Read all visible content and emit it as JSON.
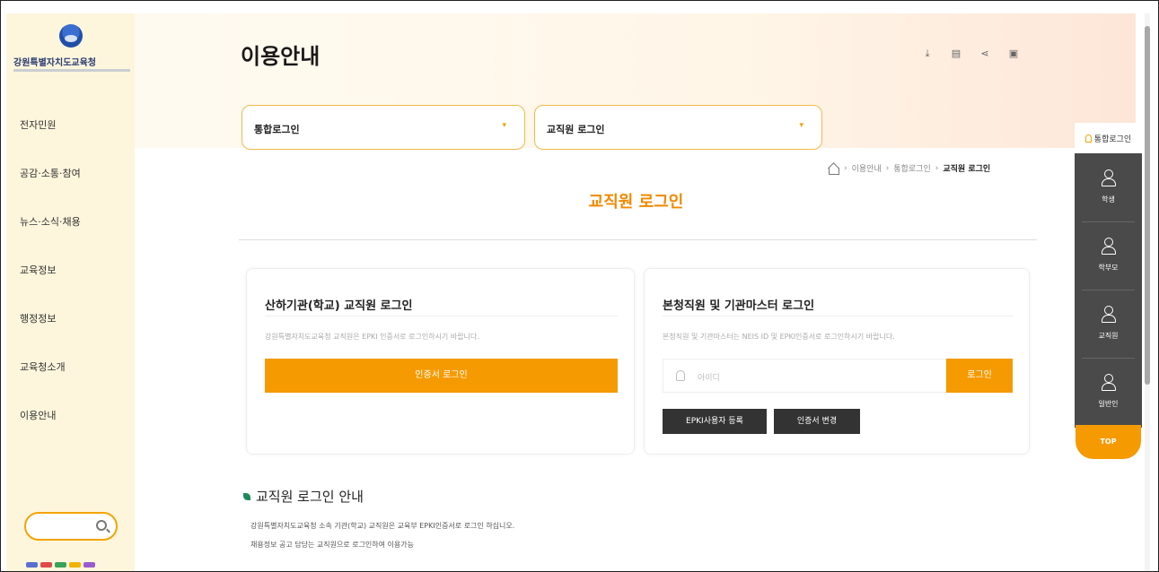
{
  "sidebar": {
    "logo_text": "강원특별자치도교육청",
    "nav_items": [
      "전자민원",
      "공감·소통·참여",
      "뉴스·소식·채용",
      "교육정보",
      "행정정보",
      "교육청소개",
      "이용안내"
    ],
    "color_dots": [
      "#5a6fd1",
      "#e04a4a",
      "#3aa35a",
      "#f0b400",
      "#9a5ad1"
    ]
  },
  "header": {
    "title": "이용안내",
    "util_icons": [
      "download-icon",
      "print-icon",
      "share-icon",
      "printer-icon"
    ]
  },
  "selects": {
    "primary": "통합로그인",
    "secondary": "교직원 로그인"
  },
  "breadcrumb": {
    "items": [
      "이용안내",
      "통합로그인"
    ],
    "current": "교직원 로그인",
    "separator": "›"
  },
  "section": {
    "title": "교직원 로그인"
  },
  "card_left": {
    "title": "산하기관(학교) 교직원 로그인",
    "desc": "강원특별자치도교육청 교직원은 EPKI 인증서로 로그인하시기 바랍니다.",
    "button": "인증서 로그인"
  },
  "card_right": {
    "title": "본청직원 및 기관마스터 로그인",
    "desc": "본청직원 및 기관마스터는 NEIS ID 및 EPKI인증서로 로그인하시기 바랍니다.",
    "id_placeholder": "아이디",
    "login_button": "로그인",
    "epki_button": "EPKI사용자 등록",
    "cert_change_button": "인증서 변경"
  },
  "guide": {
    "title": "교직원 로그인 안내",
    "lines": [
      "강원특별자치도교육청 소속 기관(학교) 교직원은 교육부 EPKI인증서로 로그인 하십니오.",
      "채용정보 공고 담당는 교직원으로 로그인하여 이용가능"
    ]
  },
  "quick": {
    "top_label": "통합로그인",
    "items": [
      "학생",
      "학부모",
      "교직원",
      "일반인"
    ],
    "top_button": "TOP"
  },
  "colors": {
    "accent": "#f59a00",
    "title_orange": "#f08a00",
    "sidebar_bg": "#fdf6dc",
    "quick_bg": "#4a4a4a"
  }
}
